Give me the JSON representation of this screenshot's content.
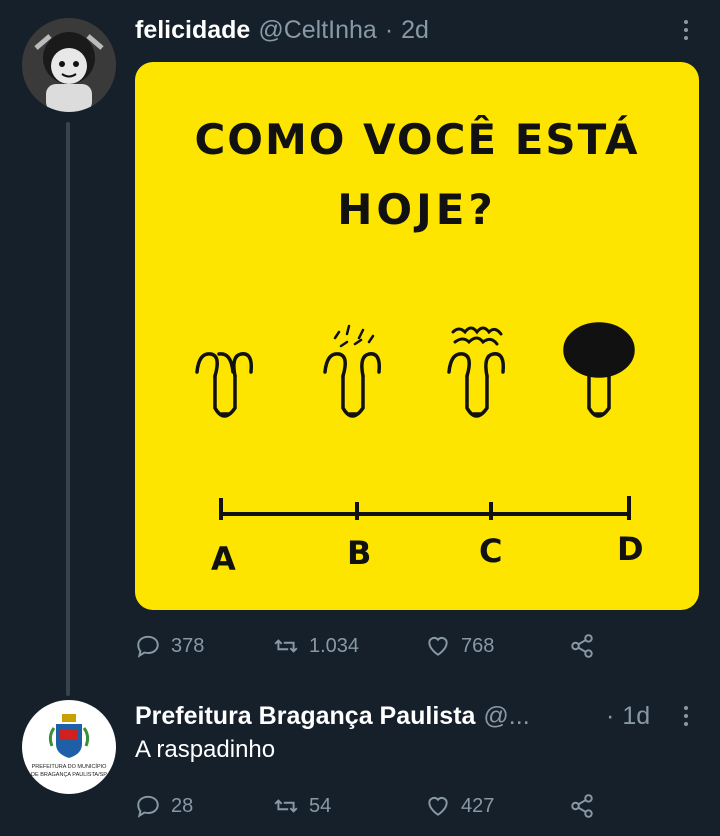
{
  "tweets": [
    {
      "name": "felicidade",
      "handle": "@CeltInha",
      "separator": "·",
      "time": "2d",
      "image_text": {
        "question_line1": "COMO VOCÊ ESTÁ",
        "question_line2": "HOJE?",
        "scale_labels": [
          "A",
          "B",
          "C",
          "D"
        ]
      },
      "stats": {
        "replies": "378",
        "retweets": "1.034",
        "likes": "768"
      }
    },
    {
      "name": "Prefeitura Bragança Paulista",
      "handle": "@...",
      "separator": "·",
      "time": "1d",
      "text": "A raspadinho",
      "avatar_text": "PREFEITURA DO MUNICÍPIO DE BRAGANÇA PAULISTA/SP",
      "stats": {
        "replies": "28",
        "retweets": "54",
        "likes": "427"
      }
    }
  ],
  "colors": {
    "background": "#15202b",
    "muted": "#8899a6",
    "image_yellow": "#fde500"
  },
  "icons": [
    "reply-icon",
    "retweet-icon",
    "like-icon",
    "share-icon",
    "more-icon"
  ]
}
